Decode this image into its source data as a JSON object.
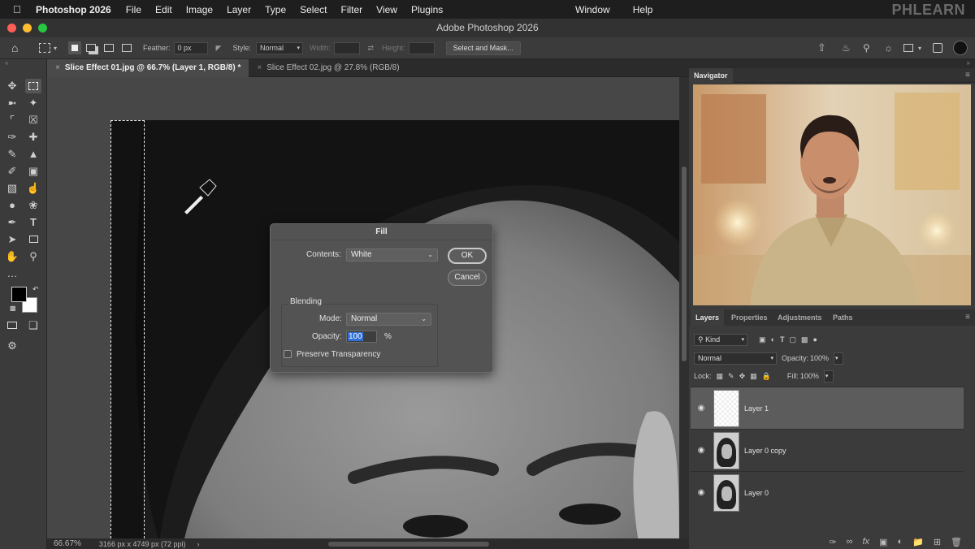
{
  "menubar": {
    "app_name": "Photoshop 2026",
    "items": [
      "File",
      "Edit",
      "Image",
      "Layer",
      "Type",
      "Select",
      "Filter",
      "View",
      "Plugins"
    ],
    "right_items": [
      "Window",
      "Help"
    ],
    "brand": "PHLEARN"
  },
  "titlebar": {
    "title": "Adobe Photoshop 2026"
  },
  "options": {
    "feather_label": "Feather:",
    "feather_value": "0 px",
    "style_label": "Style:",
    "style_value": "Normal",
    "width_label": "Width:",
    "height_label": "Height:",
    "select_mask": "Select and Mask..."
  },
  "tabs": [
    {
      "label": "Slice Effect 01.jpg @ 66.7% (Layer 1, RGB/8) *",
      "active": true
    },
    {
      "label": "Slice Effect 02.jpg @ 27.8% (RGB/8)",
      "active": false
    }
  ],
  "status": {
    "zoom": "66.67%",
    "doc_info": "3166 px x 4749 px (72 ppi)"
  },
  "fill_dialog": {
    "title": "Fill",
    "contents_label": "Contents:",
    "contents_value": "White",
    "ok": "OK",
    "cancel": "Cancel",
    "blending_label": "Blending",
    "mode_label": "Mode:",
    "mode_value": "Normal",
    "opacity_label": "Opacity:",
    "opacity_value": "100",
    "opacity_unit": "%",
    "preserve_label": "Preserve Transparency"
  },
  "navigator": {
    "title": "Navigator"
  },
  "layers_panel": {
    "tabs": [
      "Layers",
      "Properties",
      "Adjustments",
      "Paths"
    ],
    "kind_label": "Kind",
    "blend_mode": "Normal",
    "opacity_label": "Opacity:",
    "opacity_value": "100%",
    "lock_label": "Lock:",
    "fill_label": "Fill:",
    "fill_value": "100%",
    "layers": [
      {
        "name": "Layer 1",
        "selected": true
      },
      {
        "name": "Layer 0 copy",
        "selected": false
      },
      {
        "name": "Layer 0",
        "selected": false
      }
    ]
  },
  "colors": {
    "accent_blue": "#2f6fd6",
    "dialog_bg": "#535353",
    "panel_bg": "#3b3b3b"
  }
}
